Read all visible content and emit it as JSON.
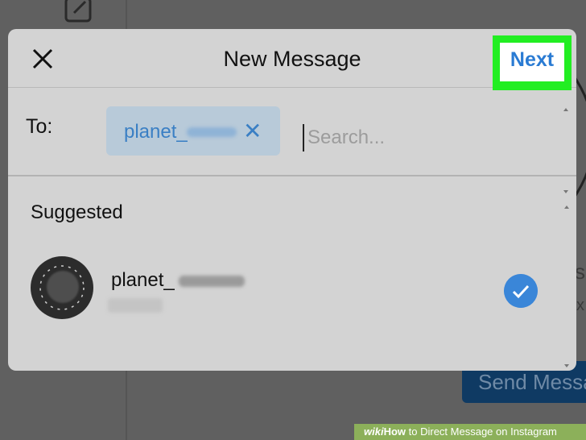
{
  "background": {
    "send_button_label": "Send Message"
  },
  "modal": {
    "title": "New Message",
    "next_label": "Next",
    "to_label": "To:",
    "recipient_chip": "planet_",
    "search_placeholder": "Search...",
    "section_label": "Suggested",
    "suggested": [
      {
        "username": "planet_",
        "selected": true
      }
    ]
  },
  "watermark": {
    "brand": "wiki",
    "how": "How",
    "text": " to Direct Message on Instagram"
  },
  "colors": {
    "accent": "#3a86d8",
    "highlight": "#22ee22",
    "modal_bg": "#d3d3d3"
  },
  "icons": [
    "compose-icon",
    "close-icon",
    "remove-recipient-icon",
    "checkmark-icon"
  ]
}
